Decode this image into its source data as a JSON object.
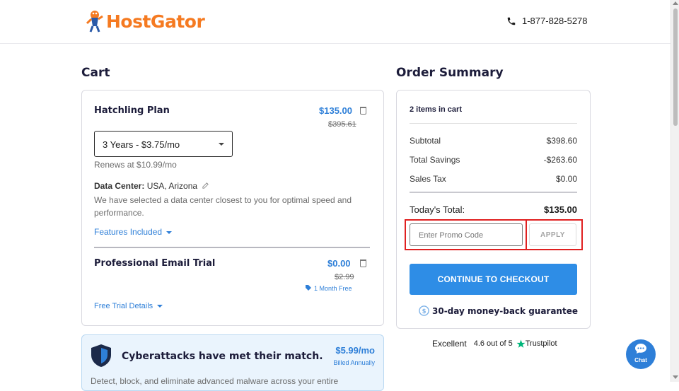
{
  "header": {
    "brand": "HostGator",
    "phone": "1-877-828-5278"
  },
  "cart": {
    "title": "Cart",
    "items": [
      {
        "name": "Hatchling Plan",
        "price": "$135.00",
        "original_price": "$395.61",
        "term_selected": "3 Years - $3.75/mo",
        "renews": "Renews at $10.99/mo",
        "data_center_label": "Data Center:",
        "data_center_value": "USA, Arizona",
        "data_center_note": "We have selected a data center closest to you for optimal speed and performance.",
        "features_link": "Features Included"
      },
      {
        "name": "Professional Email Trial",
        "price": "$0.00",
        "original_price": "$2.99",
        "tag": "1 Month Free",
        "details_link": "Free Trial Details"
      }
    ]
  },
  "promo_banner": {
    "title": "Cyberattacks have met their match.",
    "price": "$5.99/mo",
    "billing": "Billed Annually",
    "description": "Detect, block, and eliminate advanced malware across your entire"
  },
  "summary": {
    "title": "Order Summary",
    "items_count": "2 items in cart",
    "lines": [
      {
        "label": "Subtotal",
        "value": "$398.60"
      },
      {
        "label": "Total Savings",
        "value": "-$263.60"
      },
      {
        "label": "Sales Tax",
        "value": "$0.00"
      }
    ],
    "total_label": "Today's Total:",
    "total_value": "$135.00",
    "promo_placeholder": "Enter Promo Code",
    "apply_label": "APPLY",
    "checkout_label": "CONTINUE TO CHECKOUT",
    "guarantee": "30-day money-back guarantee"
  },
  "trustpilot": {
    "rating_word": "Excellent",
    "score": "4.6 out of 5",
    "brand": "Trustpilot"
  },
  "chat": {
    "label": "Chat"
  },
  "colors": {
    "brand_orange": "#f57a21",
    "link_blue": "#2e7fd8",
    "cta_blue": "#2e8de6",
    "highlight_red": "#e02020",
    "trustpilot_green": "#00b67a"
  }
}
